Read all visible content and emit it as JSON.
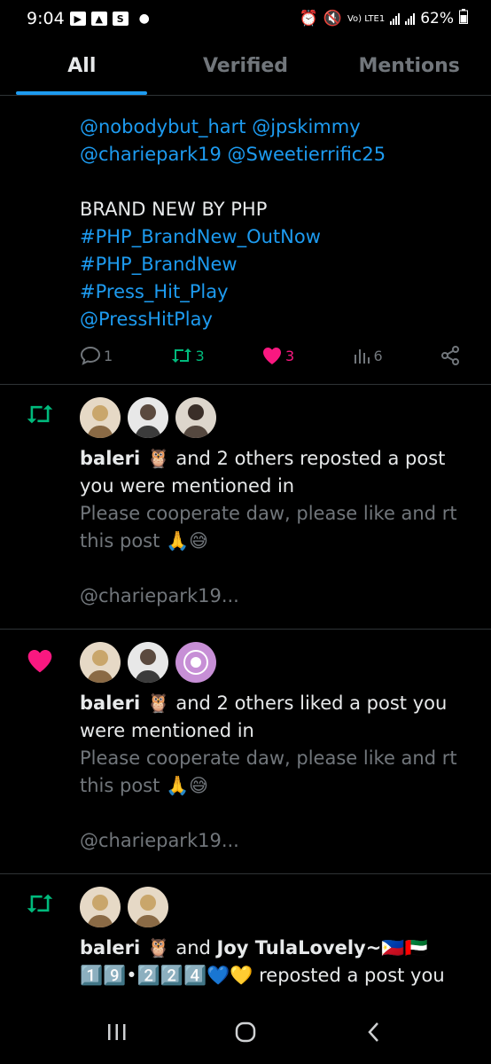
{
  "status_bar": {
    "time": "9:04",
    "s_icon": "S",
    "battery": "62%",
    "network": "Vo) LTE1",
    "icons": [
      "youtube-icon",
      "gallery-icon",
      "s-app-icon",
      "alarm-icon",
      "mute-icon",
      "wifi-icon",
      "signal-icon",
      "battery-icon"
    ]
  },
  "tabs": [
    {
      "label": "All",
      "active": true
    },
    {
      "label": "Verified",
      "active": false
    },
    {
      "label": "Mentions",
      "active": false
    }
  ],
  "top_post": {
    "mentions_line1": "@nobodybut_hart @jpskimmy",
    "mentions_line2": "@chariepark19 @Sweetierrific25",
    "title": "BRAND NEW BY PHP",
    "hashtag1": "#PHP_BrandNew_OutNow",
    "hashtag2": "#PHP_BrandNew",
    "hashtag3": "#Press_Hit_Play",
    "mention_final": "@PressHitPlay",
    "reply_count": "1",
    "repost_count": "3",
    "like_count": "3",
    "view_count": "6"
  },
  "notifications": [
    {
      "type": "repost",
      "user": "baleri 🦉",
      "text": " and 2 others reposted a post you were mentioned in",
      "preview": "Please cooperate daw, please like and rt this post 🙏😅",
      "handle": "@chariepark19..."
    },
    {
      "type": "like",
      "user": "baleri 🦉",
      "text": " and 2 others liked a post you were mentioned in",
      "preview": "Please cooperate daw, please like and rt this post 🙏😅",
      "handle": "@chariepark19..."
    },
    {
      "type": "repost",
      "user": "baleri 🦉",
      "mid": " and ",
      "user2": "Joy TulaLovely~🇵🇭🇦🇪",
      "line2": "1️⃣9️⃣•2️⃣2️⃣4️⃣💙💛",
      "text": " reposted a post you"
    }
  ],
  "colors": {
    "accent": "#1d9bf0",
    "repost": "#00ba7c",
    "like": "#f91880",
    "muted": "#71767b"
  }
}
